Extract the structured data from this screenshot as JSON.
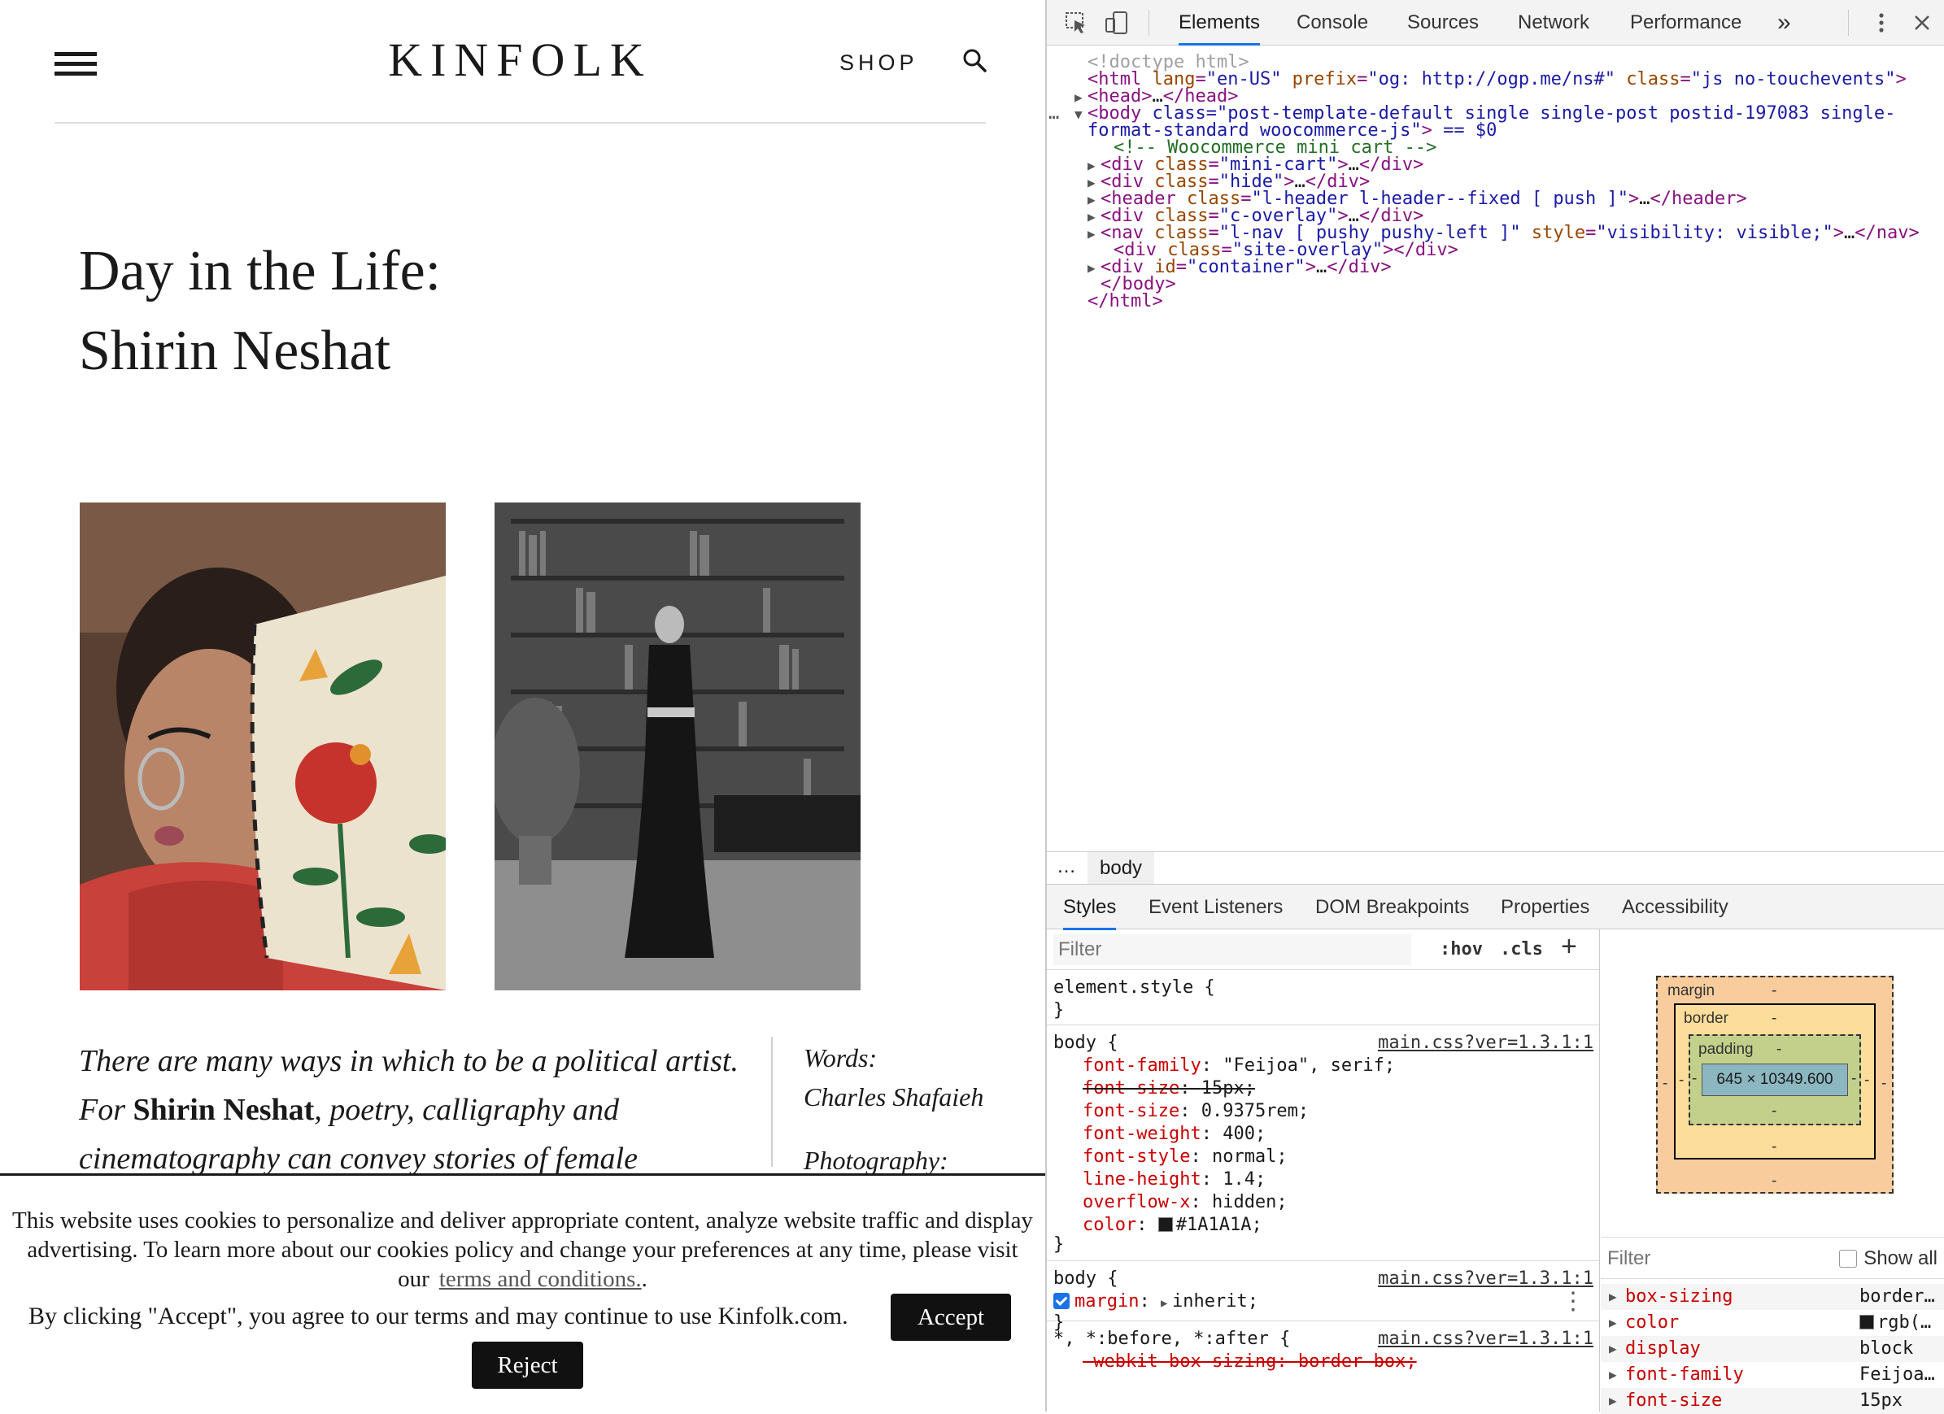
{
  "site": {
    "logo": "KINFOLK",
    "shop_label": "SHOP",
    "title_line1": "Day in the Life:",
    "title_line2": "Shirin Neshat",
    "lede_part1": "There are many ways in which to be a political artist. For ",
    "lede_bold": "Shirin Neshat",
    "lede_part2": ", poetry, calligraphy and cinematography can convey stories of female",
    "credits": {
      "words_label": "Words:",
      "words_name": "Charles Shafaieh",
      "photo_label": "Photography:"
    },
    "cookie": {
      "text": "This website uses cookies to personalize and deliver appropriate content, analyze website traffic and display advertising. To learn more about our cookies policy and change your preferences at any time, please visit our",
      "link": "terms and conditions.",
      "tail": ".",
      "agree_text": "By clicking \"Accept\", you agree to our terms and may continue to use Kinfolk.com.",
      "accept_label": "Accept",
      "reject_label": "Reject"
    }
  },
  "devtools": {
    "tabs": [
      "Elements",
      "Console",
      "Sources",
      "Network",
      "Performance"
    ],
    "more": "»",
    "dom": [
      {
        "indent": 1,
        "tri": "",
        "text": "<!doctype html>",
        "kind": "muted"
      },
      {
        "indent": 1,
        "tri": "",
        "text": "<html lang=\"en-US\" prefix=\"og: http://ogp.me/ns#\" class=\"js no-touchevents\">",
        "kind": "tag"
      },
      {
        "indent": 1,
        "tri": "▶",
        "text": "<head>…</head>",
        "kind": "tag"
      },
      {
        "indent": 1,
        "tri": "▼",
        "text": "<body class=\"post-template-default single single-post postid-197083 single-",
        "kind": "tag",
        "selected": true
      },
      {
        "indent": 1,
        "tri": "",
        "text": "format-standard woocommerce-js\"> == $0",
        "kind": "tag",
        "selected": true
      },
      {
        "indent": 3,
        "tri": "",
        "text": "<!-- Woocommerce mini cart -->",
        "kind": "comment"
      },
      {
        "indent": 2,
        "tri": "▶",
        "text": "<div class=\"mini-cart\">…</div>",
        "kind": "tag"
      },
      {
        "indent": 2,
        "tri": "▶",
        "text": "<div class=\"hide\">…</div>",
        "kind": "tag"
      },
      {
        "indent": 2,
        "tri": "▶",
        "text": "<header class=\"l-header l-header--fixed [ push ]\">…</header>",
        "kind": "tag"
      },
      {
        "indent": 2,
        "tri": "▶",
        "text": "<div class=\"c-overlay\">…</div>",
        "kind": "tag"
      },
      {
        "indent": 2,
        "tri": "▶",
        "text": "<nav class=\"l-nav [ pushy pushy-left ]\" style=\"visibility: visible;\">…</nav>",
        "kind": "tag"
      },
      {
        "indent": 3,
        "tri": "",
        "text": "<div class=\"site-overlay\"></div>",
        "kind": "tag"
      },
      {
        "indent": 2,
        "tri": "▶",
        "text": "<div id=\"container\">…</div>",
        "kind": "tag"
      },
      {
        "indent": 2,
        "tri": "",
        "text": "</body>",
        "kind": "tag"
      },
      {
        "indent": 1,
        "tri": "",
        "text": "</html>",
        "kind": "tag"
      }
    ],
    "ellipsis": "…",
    "crumb": "body",
    "subtabs": [
      "Styles",
      "Event Listeners",
      "DOM Breakpoints",
      "Properties",
      "Accessibility"
    ],
    "filter_placeholder": "Filter",
    "hov": ":hov",
    "cls": ".cls",
    "plus": "+",
    "element_style": "element.style {",
    "brace_close": "}",
    "rule1": {
      "selector": "body {",
      "source": "main.css?ver=1.3.1:1",
      "props": [
        {
          "name": "font-family",
          "value": "\"Feijoa\", serif;",
          "strike": false
        },
        {
          "name": "font-size",
          "value": "15px;",
          "strike": true
        },
        {
          "name": "font-size",
          "value": "0.9375rem;",
          "strike": false
        },
        {
          "name": "font-weight",
          "value": "400;",
          "strike": false
        },
        {
          "name": "font-style",
          "value": "normal;",
          "strike": false
        },
        {
          "name": "line-height",
          "value": "1.4;",
          "strike": false
        },
        {
          "name": "overflow-x",
          "value": "hidden;",
          "strike": false
        },
        {
          "name": "color",
          "value": "#1A1A1A;",
          "strike": false
        }
      ]
    },
    "rule2": {
      "selector": "body {",
      "source": "main.css?ver=1.3.1:1",
      "prop_name": "margin",
      "prop_value": "inherit;"
    },
    "rule3": {
      "selector": "*, *:before, *:after {",
      "source": "main.css?ver=1.3.1:1",
      "prop": "-webkit-box-sizing: border-box;"
    },
    "boxmodel": {
      "margin": "margin",
      "border": "border",
      "padding": "padding",
      "content": "645 × 10349.600",
      "dash": "-"
    },
    "computed": {
      "filter_placeholder": "Filter",
      "show_all": "Show all",
      "props": [
        {
          "name": "box-sizing",
          "value": "border…"
        },
        {
          "name": "color",
          "value": "rgb(…"
        },
        {
          "name": "display",
          "value": "block"
        },
        {
          "name": "font-family",
          "value": "Feijoa…"
        },
        {
          "name": "font-size",
          "value": "15px"
        }
      ]
    }
  }
}
